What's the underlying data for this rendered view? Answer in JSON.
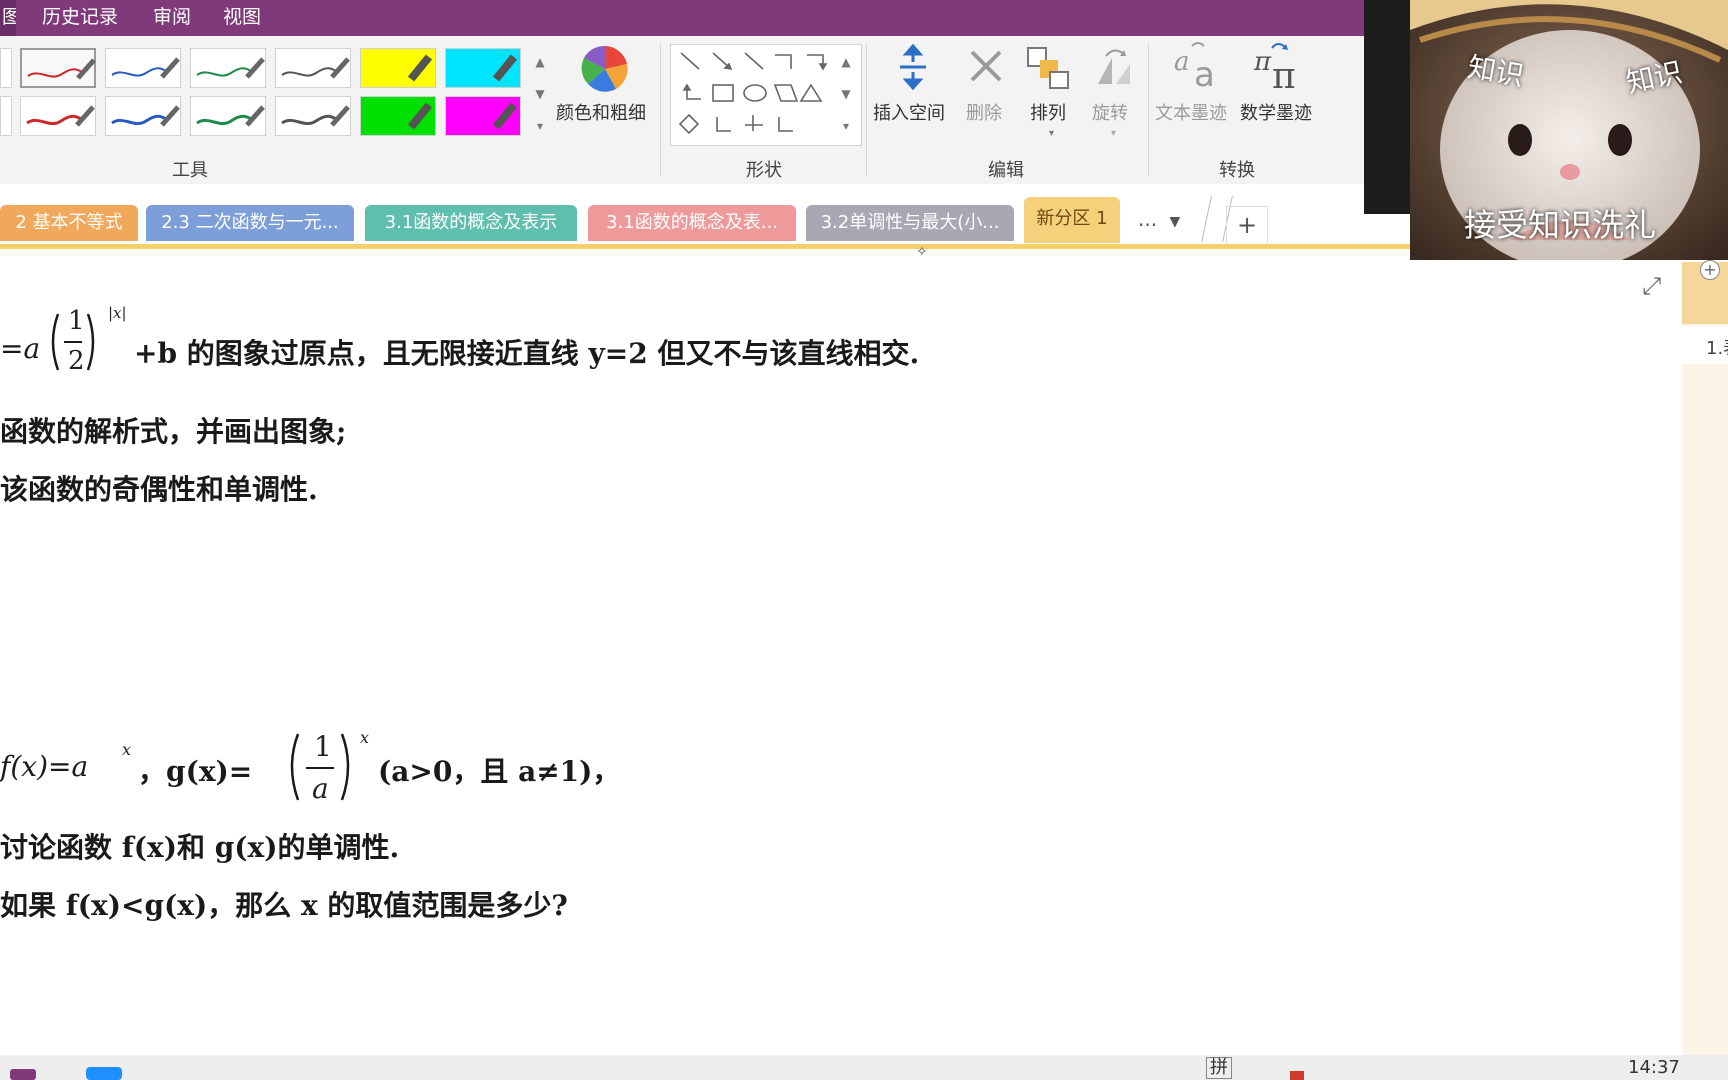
{
  "menubar": {
    "items": [
      {
        "label": "图"
      },
      {
        "label": "历史记录"
      },
      {
        "label": "审阅"
      },
      {
        "label": "视图"
      }
    ]
  },
  "ribbon": {
    "tools_group_label": "工具",
    "shapes_group_label": "形状",
    "edit_group_label": "编辑",
    "convert_group_label": "转换",
    "color_button": "颜色和粗细",
    "insert_space": "插入空间",
    "delete": "删除",
    "arrange": "排列",
    "rotate": "旋转",
    "ink_to_text": "文本墨迹",
    "ink_to_math": "数学墨迹",
    "pens": [
      {
        "color": "#cc2a2a"
      },
      {
        "color": "#2a5bbf"
      },
      {
        "color": "#1e8a4a"
      },
      {
        "color": "#555555"
      },
      {
        "color": "#cc2a2a"
      },
      {
        "color": "#2a5bbf"
      },
      {
        "color": "#1e8a4a"
      },
      {
        "color": "#555555"
      }
    ],
    "highlighters": [
      {
        "color": "#ffff00"
      },
      {
        "color": "#00e5ff"
      },
      {
        "color": "#00e000"
      },
      {
        "color": "#ff00ff"
      }
    ]
  },
  "tabs": [
    {
      "label": "2 基本不等式",
      "color": "#f0a95c"
    },
    {
      "label": "2.3 二次函数与一元...",
      "color": "#7d9fd9"
    },
    {
      "label": "3.1函数的概念及表示",
      "color": "#5fbfae"
    },
    {
      "label": "3.1函数的概念及表...",
      "color": "#ef9a9a"
    },
    {
      "label": "3.2单调性与最大(小...",
      "color": "#a8a8b4"
    },
    {
      "label": "新分区 1",
      "color": "#f6d07a"
    }
  ],
  "tab_more": "...",
  "tab_add": "+",
  "content": {
    "p1_line1_a": "=a",
    "p1_frac_num": "1",
    "p1_frac_den": "2",
    "p1_exp": "|x|",
    "p1_line1_b": "+b 的图象过原点，且无限接近直线 y=2 但又不与该直线相交.",
    "p1_line2": "函数的解析式，并画出图象;",
    "p1_line3": "该函数的奇偶性和单调性.",
    "p2_line1_a": "f(x)=a",
    "p2_exp_x": "x",
    "p2_line1_b": "，g(x)=",
    "p2_frac_num": "1",
    "p2_frac_den": "a",
    "p2_exp_x2": "x",
    "p2_line1_c": "(a>0，且 a≠1)，",
    "p2_line2": "讨论函数 f(x)和 g(x)的单调性.",
    "p2_line3": "如果 f(x)<g(x)，那么 x 的取值范围是多少?"
  },
  "right_panel": {
    "page_label": "1.表"
  },
  "webcam": {
    "text_left": "知识",
    "text_right": "知识",
    "caption": "接受知识洗礼"
  },
  "taskbar": {
    "clock": "14:37",
    "ime": "拼"
  }
}
